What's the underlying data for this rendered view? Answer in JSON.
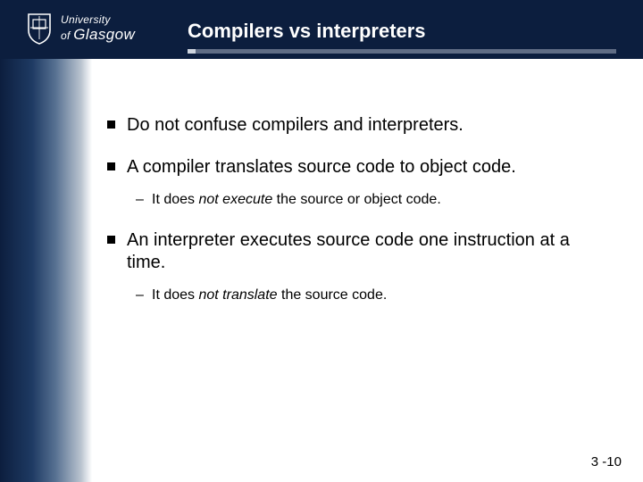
{
  "header": {
    "logo": {
      "university_line": "University",
      "of_line": "of",
      "glasgow_line": "Glasgow"
    },
    "title": "Compilers vs interpreters"
  },
  "bullets": [
    {
      "text": "Do not confuse compilers and interpreters."
    },
    {
      "text": "A compiler translates source code to object code.",
      "sub": [
        {
          "prefix": "It does ",
          "em": "not execute",
          "suffix": " the source or object code."
        }
      ]
    },
    {
      "text": "An interpreter executes source code one instruction at a time.",
      "sub": [
        {
          "prefix": "It does ",
          "em": "not translate",
          "suffix": " the source code."
        }
      ]
    }
  ],
  "page_number": "3 -10"
}
